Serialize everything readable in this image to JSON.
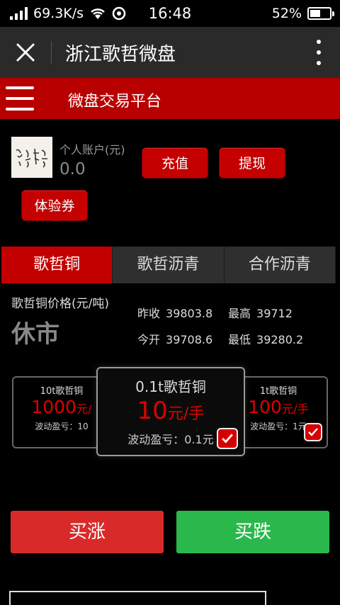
{
  "status_bar": {
    "speed": "69.3K/s",
    "time": "16:48",
    "battery": "52%",
    "battery_level": 0.52
  },
  "titlebar": {
    "title": "浙江歌哲微盘"
  },
  "header": {
    "title": "微盘交易平台"
  },
  "account": {
    "label": "个人账户(元)",
    "balance": "0.0",
    "recharge_label": "充值",
    "withdraw_label": "提现",
    "coupon_label": "体验券"
  },
  "tabs": [
    {
      "label": "歌哲铜",
      "active": true
    },
    {
      "label": "歌哲沥青",
      "active": false
    },
    {
      "label": "合作沥青",
      "active": false
    }
  ],
  "price": {
    "label": "歌哲铜价格(元/吨)",
    "status": "休市",
    "prev_close_label": "昨收",
    "prev_close": "39803.8",
    "high_label": "最高",
    "high": "39712",
    "open_label": "今开",
    "open": "39708.6",
    "low_label": "最低",
    "low": "39280.2"
  },
  "products": {
    "left": {
      "name": "10t歌哲铜",
      "price": "1000",
      "unit": "元/",
      "sub": "波动盈亏：10"
    },
    "middle": {
      "name": "0.1t歌哲铜",
      "price": "10",
      "unit": "元/手",
      "sub": "波动盈亏：0.1元"
    },
    "right": {
      "name": "1t歌哲铜",
      "price": "100",
      "unit": "元/手",
      "sub": "波动盈亏：1元"
    }
  },
  "actions": {
    "buy_up": "买涨",
    "buy_down": "买跌"
  },
  "colors": {
    "accent_red": "#b80000",
    "buy_up": "#d92a2a",
    "buy_down": "#2ab84c"
  }
}
